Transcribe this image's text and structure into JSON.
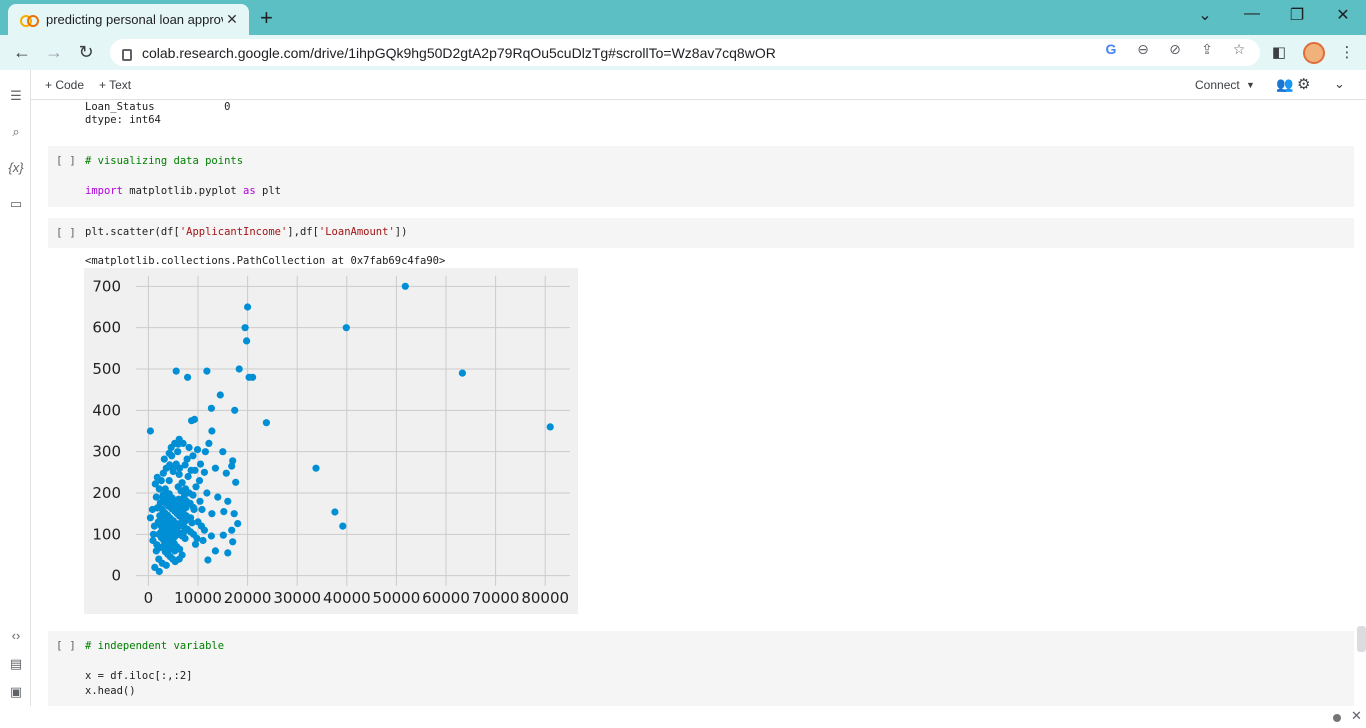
{
  "browser": {
    "tab_title": "predicting personal loan approva",
    "url": "colab.research.google.com/drive/1ihpGQk9hg50D2gtA2p79RqOu5cuDlzTg#scrollTo=Wz8av7cq8wOR"
  },
  "colab_toolbar": {
    "code_label": "+ Code",
    "text_label": "+ Text",
    "connect_label": "Connect"
  },
  "cells": {
    "prev_output": [
      "Loan_Status           0",
      "dtype: int64"
    ],
    "cell1": {
      "run_label": "[ ]",
      "comment": "# visualizing data points",
      "import_kw": "import",
      "import_rest": " matplotlib.pyplot ",
      "as_kw": "as",
      "alias": " plt"
    },
    "cell2": {
      "run_label": "[ ]",
      "code_pre": "plt.scatter(df[",
      "str1": "'ApplicantIncome'",
      "code_mid": "],df[",
      "str2": "'LoanAmount'",
      "code_post": "])",
      "output_text": "<matplotlib.collections.PathCollection at 0x7fab69c4fa90>"
    },
    "cell3": {
      "run_label": "[ ]",
      "comment": "# independent variable",
      "line1": "x = df.iloc[:,:2]",
      "line2": "x.head()"
    }
  },
  "chart_data": {
    "type": "scatter",
    "xlim": [
      -2500,
      85000
    ],
    "ylim": [
      -25,
      725
    ],
    "xticks": [
      0,
      10000,
      20000,
      30000,
      40000,
      50000,
      60000,
      70000,
      80000
    ],
    "yticks": [
      0,
      100,
      200,
      300,
      400,
      500,
      600,
      700
    ],
    "grid": true,
    "color": "#008fd5",
    "points": [
      [
        51800,
        700
      ],
      [
        20000,
        650
      ],
      [
        19500,
        600
      ],
      [
        39900,
        600
      ],
      [
        19800,
        568
      ],
      [
        81000,
        360
      ],
      [
        63300,
        490
      ],
      [
        5600,
        495
      ],
      [
        11800,
        495
      ],
      [
        18300,
        500
      ],
      [
        7900,
        480
      ],
      [
        20300,
        480
      ],
      [
        21000,
        480
      ],
      [
        14500,
        437
      ],
      [
        12700,
        405
      ],
      [
        17400,
        400
      ],
      [
        23800,
        370
      ],
      [
        400,
        350
      ],
      [
        8700,
        375
      ],
      [
        9300,
        378
      ],
      [
        12800,
        350
      ],
      [
        6200,
        330
      ],
      [
        6000,
        318
      ],
      [
        8200,
        310
      ],
      [
        9900,
        305
      ],
      [
        11500,
        300
      ],
      [
        12200,
        320
      ],
      [
        15000,
        300
      ],
      [
        33800,
        260
      ],
      [
        37600,
        154
      ],
      [
        39200,
        120
      ],
      [
        17000,
        278
      ],
      [
        16800,
        265
      ],
      [
        9000,
        290
      ],
      [
        10500,
        270
      ],
      [
        11300,
        250
      ],
      [
        13500,
        260
      ],
      [
        15700,
        248
      ],
      [
        17600,
        226
      ],
      [
        14000,
        190
      ],
      [
        16000,
        180
      ],
      [
        11800,
        200
      ],
      [
        10400,
        180
      ],
      [
        9200,
        160
      ],
      [
        8500,
        140
      ],
      [
        10800,
        160
      ],
      [
        12800,
        150
      ],
      [
        15200,
        155
      ],
      [
        17300,
        150
      ],
      [
        18000,
        126
      ],
      [
        16800,
        110
      ],
      [
        15100,
        98
      ],
      [
        12700,
        96
      ],
      [
        9500,
        76
      ],
      [
        11000,
        85
      ],
      [
        13500,
        60
      ],
      [
        16000,
        55
      ],
      [
        17000,
        82
      ],
      [
        4700,
        290
      ],
      [
        3200,
        282
      ],
      [
        4300,
        268
      ],
      [
        3600,
        260
      ],
      [
        3000,
        248
      ],
      [
        5600,
        270
      ],
      [
        6300,
        260
      ],
      [
        5000,
        252
      ],
      [
        1800,
        238
      ],
      [
        4200,
        230
      ],
      [
        2600,
        230
      ],
      [
        1400,
        222
      ],
      [
        2200,
        210
      ],
      [
        3000,
        196
      ],
      [
        1600,
        190
      ],
      [
        5900,
        300
      ],
      [
        4200,
        296
      ],
      [
        7800,
        282
      ],
      [
        7400,
        268
      ],
      [
        2400,
        176
      ],
      [
        1800,
        164
      ],
      [
        800,
        160
      ],
      [
        400,
        140
      ],
      [
        1200,
        120
      ],
      [
        1000,
        100
      ],
      [
        900,
        85
      ],
      [
        1600,
        60
      ],
      [
        2100,
        40
      ],
      [
        1300,
        20
      ],
      [
        2200,
        10
      ],
      [
        2800,
        30
      ],
      [
        3600,
        25
      ],
      [
        6200,
        40
      ],
      [
        6800,
        50
      ],
      [
        12000,
        38
      ],
      [
        4900,
        260
      ],
      [
        6200,
        245
      ],
      [
        6800,
        225
      ],
      [
        7500,
        210
      ],
      [
        8200,
        200
      ],
      [
        9000,
        195
      ],
      [
        9600,
        215
      ],
      [
        10300,
        230
      ],
      [
        3400,
        210
      ],
      [
        4200,
        198
      ],
      [
        4800,
        188
      ],
      [
        5300,
        178
      ],
      [
        5900,
        168
      ],
      [
        6500,
        160
      ],
      [
        7000,
        152
      ],
      [
        7600,
        145
      ],
      [
        8200,
        138
      ],
      [
        8800,
        128
      ],
      [
        3200,
        140
      ],
      [
        3800,
        132
      ],
      [
        4500,
        125
      ],
      [
        5100,
        118
      ],
      [
        5700,
        110
      ],
      [
        6200,
        103
      ],
      [
        6800,
        96
      ],
      [
        7400,
        90
      ],
      [
        2600,
        120
      ],
      [
        3000,
        110
      ],
      [
        3500,
        100
      ],
      [
        4000,
        92
      ],
      [
        4600,
        85
      ],
      [
        5200,
        78
      ],
      [
        5700,
        70
      ],
      [
        6300,
        64
      ],
      [
        2800,
        160
      ],
      [
        3300,
        152
      ],
      [
        3900,
        146
      ],
      [
        4400,
        139
      ],
      [
        5000,
        133
      ],
      [
        5600,
        126
      ],
      [
        6100,
        120
      ],
      [
        2300,
        145
      ],
      [
        2700,
        135
      ],
      [
        3300,
        125
      ],
      [
        3900,
        118
      ],
      [
        4500,
        111
      ],
      [
        5100,
        105
      ],
      [
        5600,
        98
      ],
      [
        2100,
        100
      ],
      [
        2600,
        92
      ],
      [
        3100,
        85
      ],
      [
        3700,
        78
      ],
      [
        4200,
        72
      ],
      [
        4800,
        66
      ],
      [
        5300,
        60
      ],
      [
        3500,
        175
      ],
      [
        4100,
        168
      ],
      [
        4700,
        162
      ],
      [
        5300,
        156
      ],
      [
        5800,
        150
      ],
      [
        6300,
        144
      ],
      [
        6900,
        138
      ],
      [
        7400,
        132
      ],
      [
        2900,
        190
      ],
      [
        3500,
        185
      ],
      [
        4000,
        178
      ],
      [
        4600,
        172
      ],
      [
        5200,
        166
      ],
      [
        5700,
        160
      ],
      [
        6100,
        185
      ],
      [
        6600,
        178
      ],
      [
        7100,
        171
      ],
      [
        7600,
        165
      ],
      [
        2500,
        105
      ],
      [
        3000,
        98
      ],
      [
        3600,
        91
      ],
      [
        4100,
        84
      ],
      [
        4700,
        77
      ],
      [
        5200,
        72
      ],
      [
        5800,
        66
      ],
      [
        2000,
        130
      ],
      [
        2500,
        124
      ],
      [
        3100,
        118
      ],
      [
        3600,
        112
      ],
      [
        4200,
        106
      ],
      [
        4700,
        100
      ],
      [
        5300,
        94
      ],
      [
        7200,
        118
      ],
      [
        7900,
        112
      ],
      [
        8500,
        106
      ],
      [
        9100,
        100
      ],
      [
        6600,
        128
      ],
      [
        7100,
        105
      ],
      [
        3400,
        58
      ],
      [
        3900,
        52
      ],
      [
        4400,
        46
      ],
      [
        4900,
        40
      ],
      [
        5400,
        34
      ],
      [
        2900,
        70
      ],
      [
        3400,
        64
      ],
      [
        3900,
        58
      ],
      [
        1700,
        75
      ],
      [
        2300,
        68
      ],
      [
        10000,
        130
      ],
      [
        10700,
        120
      ],
      [
        11300,
        110
      ],
      [
        9800,
        90
      ],
      [
        4600,
        310
      ],
      [
        5300,
        320
      ],
      [
        7000,
        320
      ],
      [
        8000,
        240
      ],
      [
        8600,
        255
      ],
      [
        9400,
        255
      ],
      [
        7200,
        190
      ],
      [
        7700,
        180
      ],
      [
        8400,
        175
      ],
      [
        9100,
        165
      ],
      [
        6000,
        215
      ],
      [
        6600,
        205
      ],
      [
        7300,
        198
      ]
    ]
  }
}
